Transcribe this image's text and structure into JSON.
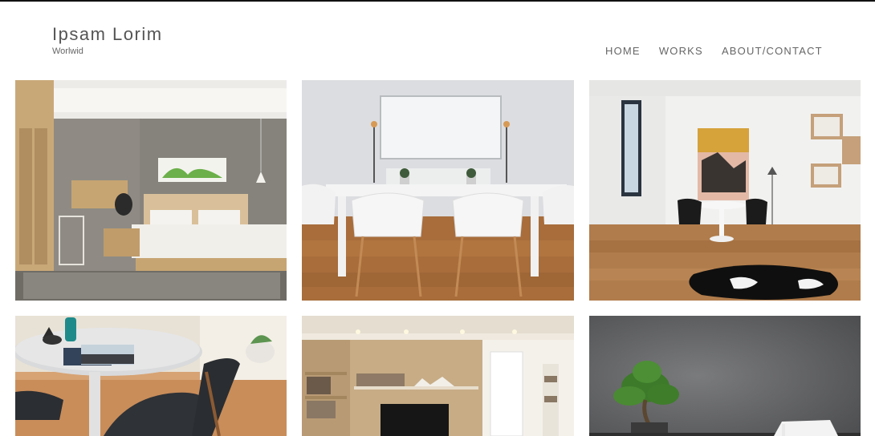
{
  "site": {
    "title": "Ipsam Lorim",
    "tagline": "Worlwid"
  },
  "nav": {
    "items": [
      {
        "label": "HOME"
      },
      {
        "label": "WORKS"
      },
      {
        "label": "ABOUT/CONTACT"
      }
    ]
  },
  "gallery": {
    "items": [
      {
        "subject": "bedroom-photo"
      },
      {
        "subject": "dining-table-photo"
      },
      {
        "subject": "white-room-with-art-photo"
      },
      {
        "subject": "round-table-chair-photo"
      },
      {
        "subject": "living-room-shelves-photo"
      },
      {
        "subject": "bonsai-desk-photo"
      }
    ]
  }
}
